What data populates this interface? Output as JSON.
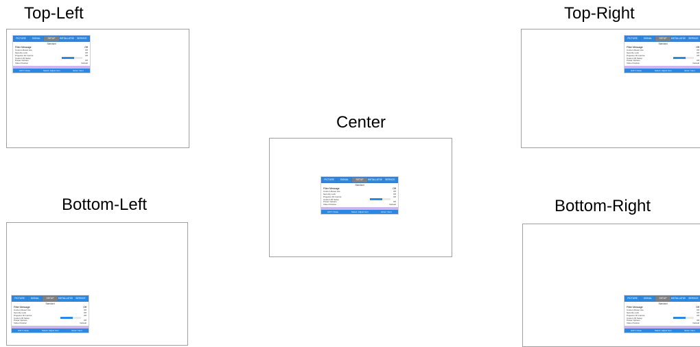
{
  "labels": {
    "top_left": "Top-Left",
    "top_right": "Top-Right",
    "center": "Center",
    "bottom_left": "Bottom-Left",
    "bottom_right": "Bottom-Right"
  },
  "osd": {
    "tabs": [
      "PICTURE",
      "SIGNAL",
      "SETUP",
      "INSTALLATION",
      "SERVICE"
    ],
    "active_tab": "SETUP",
    "title": "Standard",
    "rows": [
      {
        "label": "Filter Message",
        "value": "Off"
      },
      {
        "label": "Custom Reset Lite",
        "value": "Off"
      },
      {
        "label": "Security Lock",
        "value": "Off"
      },
      {
        "label": "Projector ID Control",
        "value": "Off"
      },
      {
        "label": "Custom ID Setup",
        "value": ""
      },
      {
        "label": "Power Options",
        "value": "Off"
      },
      {
        "label": "Video Position",
        "value": "Default"
      }
    ],
    "slider_level": 0.6,
    "footer": [
      "EXIT: Close",
      "Select: Adjust Icon",
      "Enter: Next"
    ]
  }
}
